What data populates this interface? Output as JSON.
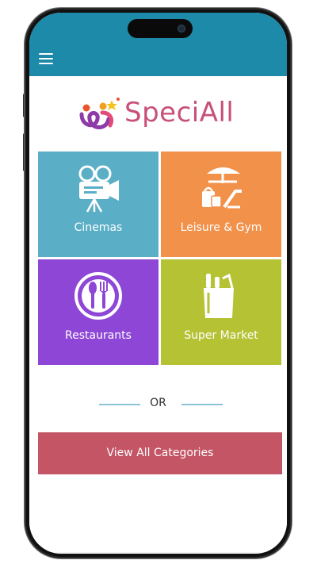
{
  "app": {
    "name": "SpeciAll"
  },
  "colors": {
    "header": "#1c8aa8",
    "cinemas": "#5aafc7",
    "leisure": "#f2914a",
    "restaurants": "#8e46d6",
    "supermarket": "#b5c234",
    "view_all": "#c35565",
    "logo_text": "#c8507a"
  },
  "categories": [
    {
      "label": "Cinemas",
      "icon": "movie-camera-icon"
    },
    {
      "label": "Leisure & Gym",
      "icon": "beach-umbrella-icon"
    },
    {
      "label": "Restaurants",
      "icon": "plate-cutlery-icon"
    },
    {
      "label": "Super Market",
      "icon": "grocery-bag-icon"
    }
  ],
  "divider": {
    "label": "OR"
  },
  "view_all": {
    "label": "View All Categories"
  }
}
